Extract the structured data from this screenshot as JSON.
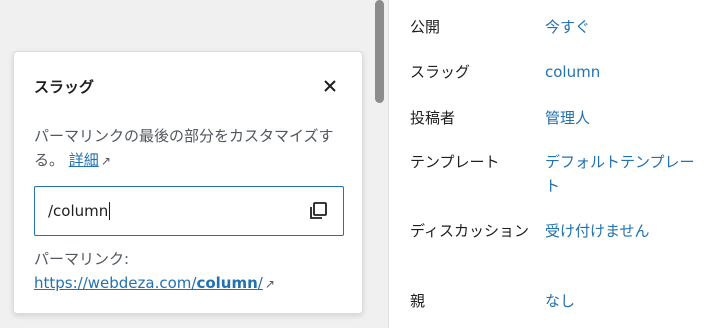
{
  "sidebar": {
    "rows": [
      {
        "label": "公開",
        "value": "今すぐ"
      },
      {
        "label": "スラッグ",
        "value": "column"
      },
      {
        "label": "投稿者",
        "value": "管理人"
      },
      {
        "label": "テンプレート",
        "value": "デフォルトテンプレート"
      },
      {
        "label": "ディスカッション",
        "value": "受け付けません"
      },
      {
        "label": "親",
        "value": "なし"
      }
    ]
  },
  "popover": {
    "title": "スラッグ",
    "description": "パーマリンクの最後の部分をカスタマイズする。",
    "details_link": "詳細",
    "slug_value": "/column",
    "permalink_label": "パーマリンク:",
    "permalink_prefix": "https://webdeza.com/",
    "permalink_slug": "column",
    "permalink_suffix": "/"
  },
  "colors": {
    "accent": "#2271b1",
    "muted_text": "#50575e"
  }
}
